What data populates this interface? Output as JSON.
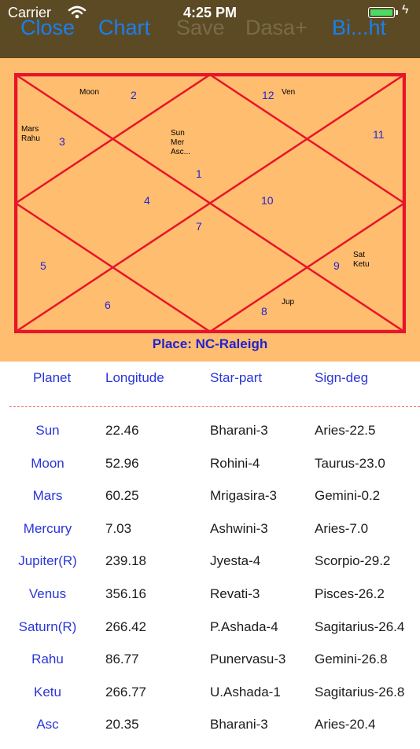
{
  "status_bar": {
    "carrier": "Carrier",
    "time": "4:25 PM"
  },
  "nav": {
    "close": "Close",
    "chart": "Chart",
    "save": "Save",
    "dasa": "Dasa+",
    "birth": "Bi...ht"
  },
  "chart": {
    "place": "Place: NC-Raleigh",
    "houses": {
      "h1": "1",
      "h2": "2",
      "h3": "3",
      "h4": "4",
      "h5": "5",
      "h6": "6",
      "h7": "7",
      "h8": "8",
      "h9": "9",
      "h10": "10",
      "h11": "11",
      "h12": "12"
    },
    "occupants": {
      "h1": "Sun\nMer\nAsc...",
      "h2": "Moon",
      "h3": "Mars\nRahu",
      "h8": "Jup",
      "h9": "Sat\nKetu",
      "h12": "Ven"
    },
    "colors": {
      "frame": "#e8142a",
      "background": "#ffbd6f",
      "house_number": "#2525d6"
    }
  },
  "table": {
    "headers": {
      "planet": "Planet",
      "longitude": "Longitude",
      "star_part": "Star-part",
      "sign_deg": "Sign-deg"
    },
    "rows": [
      {
        "planet": "Sun",
        "longitude": "22.46",
        "star_part": "Bharani-3",
        "sign_deg": "Aries-22.5"
      },
      {
        "planet": "Moon",
        "longitude": "52.96",
        "star_part": "Rohini-4",
        "sign_deg": "Taurus-23.0"
      },
      {
        "planet": "Mars",
        "longitude": "60.25",
        "star_part": "Mrigasira-3",
        "sign_deg": "Gemini-0.2"
      },
      {
        "planet": "Mercury",
        "longitude": "7.03",
        "star_part": "Ashwini-3",
        "sign_deg": "Aries-7.0"
      },
      {
        "planet": "Jupiter(R)",
        "longitude": "239.18",
        "star_part": "Jyesta-4",
        "sign_deg": "Scorpio-29.2"
      },
      {
        "planet": "Venus",
        "longitude": "356.16",
        "star_part": "Revati-3",
        "sign_deg": "Pisces-26.2"
      },
      {
        "planet": "Saturn(R)",
        "longitude": "266.42",
        "star_part": "P.Ashada-4",
        "sign_deg": "Sagitarius-26.4"
      },
      {
        "planet": "Rahu",
        "longitude": "86.77",
        "star_part": "Punervasu-3",
        "sign_deg": "Gemini-26.8"
      },
      {
        "planet": "Ketu",
        "longitude": "266.77",
        "star_part": "U.Ashada-1",
        "sign_deg": "Sagitarius-26.8"
      },
      {
        "planet": "Asc",
        "longitude": "20.35",
        "star_part": "Bharani-3",
        "sign_deg": "Aries-20.4"
      }
    ]
  }
}
